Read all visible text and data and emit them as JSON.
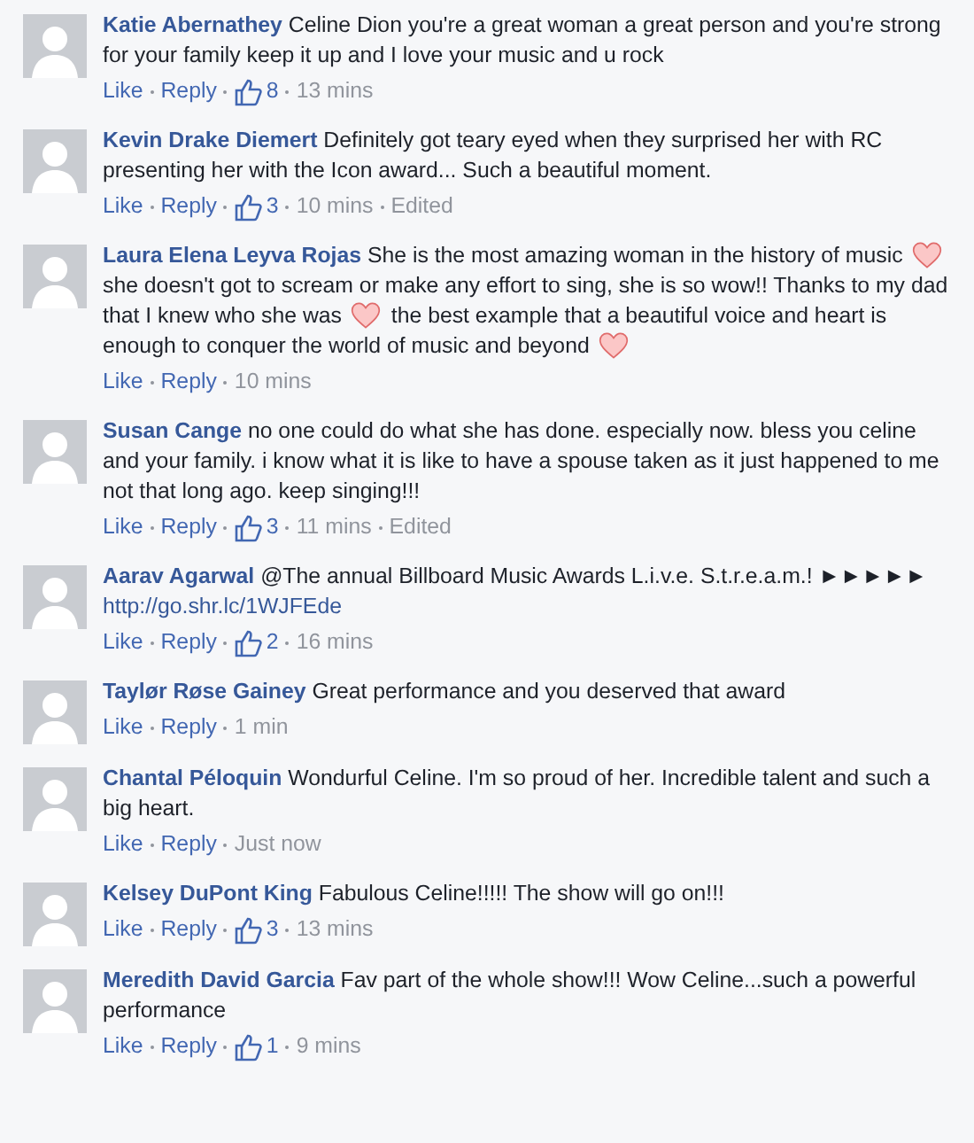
{
  "comments": [
    {
      "author": "Katie Abernathey",
      "segments": [
        {
          "kind": "text",
          "text": "Celine Dion you're a great woman a great person and you're strong for your family keep it up and I love your music and u rock"
        }
      ],
      "like": "Like",
      "reply": "Reply",
      "likes": "8",
      "time": "13 mins"
    },
    {
      "author": "Kevin Drake Diemert",
      "segments": [
        {
          "kind": "text",
          "text": "Definitely got teary eyed when they surprised her with RC presenting her with the Icon award... Such a beautiful moment."
        }
      ],
      "like": "Like",
      "reply": "Reply",
      "likes": "3",
      "time": "10 mins",
      "edited": "Edited"
    },
    {
      "author": "Laura Elena Leyva Rojas",
      "segments": [
        {
          "kind": "text",
          "text": "She is the most amazing woman in the history of music"
        },
        {
          "kind": "heart"
        },
        {
          "kind": "text",
          "text": "she doesn't got to scream or make any effort to sing, she is so wow!! Thanks to my dad that I knew who she was"
        },
        {
          "kind": "heart"
        },
        {
          "kind": "text",
          "text": "the best example that a beautiful voice and heart is enough to conquer the world of music and beyond"
        },
        {
          "kind": "heart"
        }
      ],
      "like": "Like",
      "reply": "Reply",
      "time": "10 mins"
    },
    {
      "author": "Susan Cange",
      "segments": [
        {
          "kind": "text",
          "text": "no one could do what she has done. especially now. bless you celine and your family. i know what it is like to have a spouse taken as it just happened to me not that long ago. keep singing!!!"
        }
      ],
      "like": "Like",
      "reply": "Reply",
      "likes": "3",
      "time": "11 mins",
      "edited": "Edited"
    },
    {
      "author": "Aarav Agarwal",
      "segments": [
        {
          "kind": "text",
          "text": "@The annual Billboard Music Awards L.i.v.e. S.t.r.e.a.m.! ►►►►►"
        },
        {
          "kind": "link",
          "text": "http://go.shr.lc/1WJFEde"
        }
      ],
      "like": "Like",
      "reply": "Reply",
      "likes": "2",
      "time": "16 mins"
    },
    {
      "author": "Taylør Røse Gainey",
      "segments": [
        {
          "kind": "text",
          "text": "Great performance and you deserved that award"
        }
      ],
      "like": "Like",
      "reply": "Reply",
      "time": "1 min"
    },
    {
      "author": "Chantal Péloquin",
      "segments": [
        {
          "kind": "text",
          "text": "Wondurful Celine. I'm so proud of her. Incredible talent and such a big heart."
        }
      ],
      "like": "Like",
      "reply": "Reply",
      "time": "Just now"
    },
    {
      "author": "Kelsey DuPont King",
      "segments": [
        {
          "kind": "text",
          "text": "Fabulous Celine!!!!! The show will go on!!!"
        }
      ],
      "like": "Like",
      "reply": "Reply",
      "likes": "3",
      "time": "13 mins"
    },
    {
      "author": "Meredith David Garcia",
      "segments": [
        {
          "kind": "text",
          "text": "Fav part of the whole show!!! Wow Celine...such a powerful performance"
        }
      ],
      "like": "Like",
      "reply": "Reply",
      "likes": "1",
      "time": "9 mins"
    }
  ]
}
